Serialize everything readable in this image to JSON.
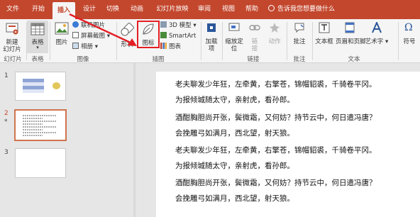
{
  "tabs": [
    {
      "label": "文件",
      "active": false
    },
    {
      "label": "开始",
      "active": false
    },
    {
      "label": "插入",
      "active": true
    },
    {
      "label": "设计",
      "active": false
    },
    {
      "label": "切换",
      "active": false
    },
    {
      "label": "动画",
      "active": false
    },
    {
      "label": "幻灯片放映",
      "active": false
    },
    {
      "label": "审阅",
      "active": false
    },
    {
      "label": "视图",
      "active": false
    },
    {
      "label": "帮助",
      "active": false
    }
  ],
  "tell_me": "告诉我您想要做什么",
  "ribbon": {
    "new_slide": [
      "新建",
      "幻灯片"
    ],
    "table": "表格",
    "picture": "图片",
    "online_picture": "联机图片",
    "screenshot": "屏幕截图",
    "album": "相册",
    "shapes": "形状",
    "icons": "图标",
    "model3d": "3D 模型",
    "smartart": "SmartArt",
    "chart": "图表",
    "addins": [
      "加载",
      "项"
    ],
    "zoom": [
      "缩放定",
      "位"
    ],
    "link": [
      "链",
      "接"
    ],
    "action": "动作",
    "comment": "批注",
    "textbox": "文本框",
    "header_footer": "页眉和页脚",
    "wordart": "艺术字",
    "symbol": "符号",
    "groups": {
      "slides": "幻灯片",
      "tables": "表格",
      "images": "图像",
      "illustrations": "插图",
      "links": "链接",
      "comments": "批注",
      "text": "文本"
    }
  },
  "colors": {
    "accent": "#c3472d",
    "highlight": "#e31e24"
  },
  "slides": [
    {
      "number": "1",
      "active": false
    },
    {
      "number": "2",
      "active": true,
      "marker": "*"
    },
    {
      "number": "3",
      "active": false
    }
  ],
  "poem": [
    "老夫聊发少年狂，左牵黄，右擎苍，锦帽貂裘，千骑卷平冈。",
    "为报倾城随太守，亲射虎，看孙郎。",
    "酒酣胸胆尚开张，鬓微霜，又何妨？持节云中，何日遣冯唐？",
    "会挽雕弓如满月，西北望，射天狼。",
    "老夫聊发少年狂，左牵黄，右擎苍，锦帽貂裘，千骑卷平冈。",
    "为报倾城随太守，亲射虎，看孙郎。",
    "酒酣胸胆尚开张，鬓微霜，又何妨？持节云中，何日遣冯唐？",
    "会挽雕弓如满月，西北望，射天狼。"
  ]
}
